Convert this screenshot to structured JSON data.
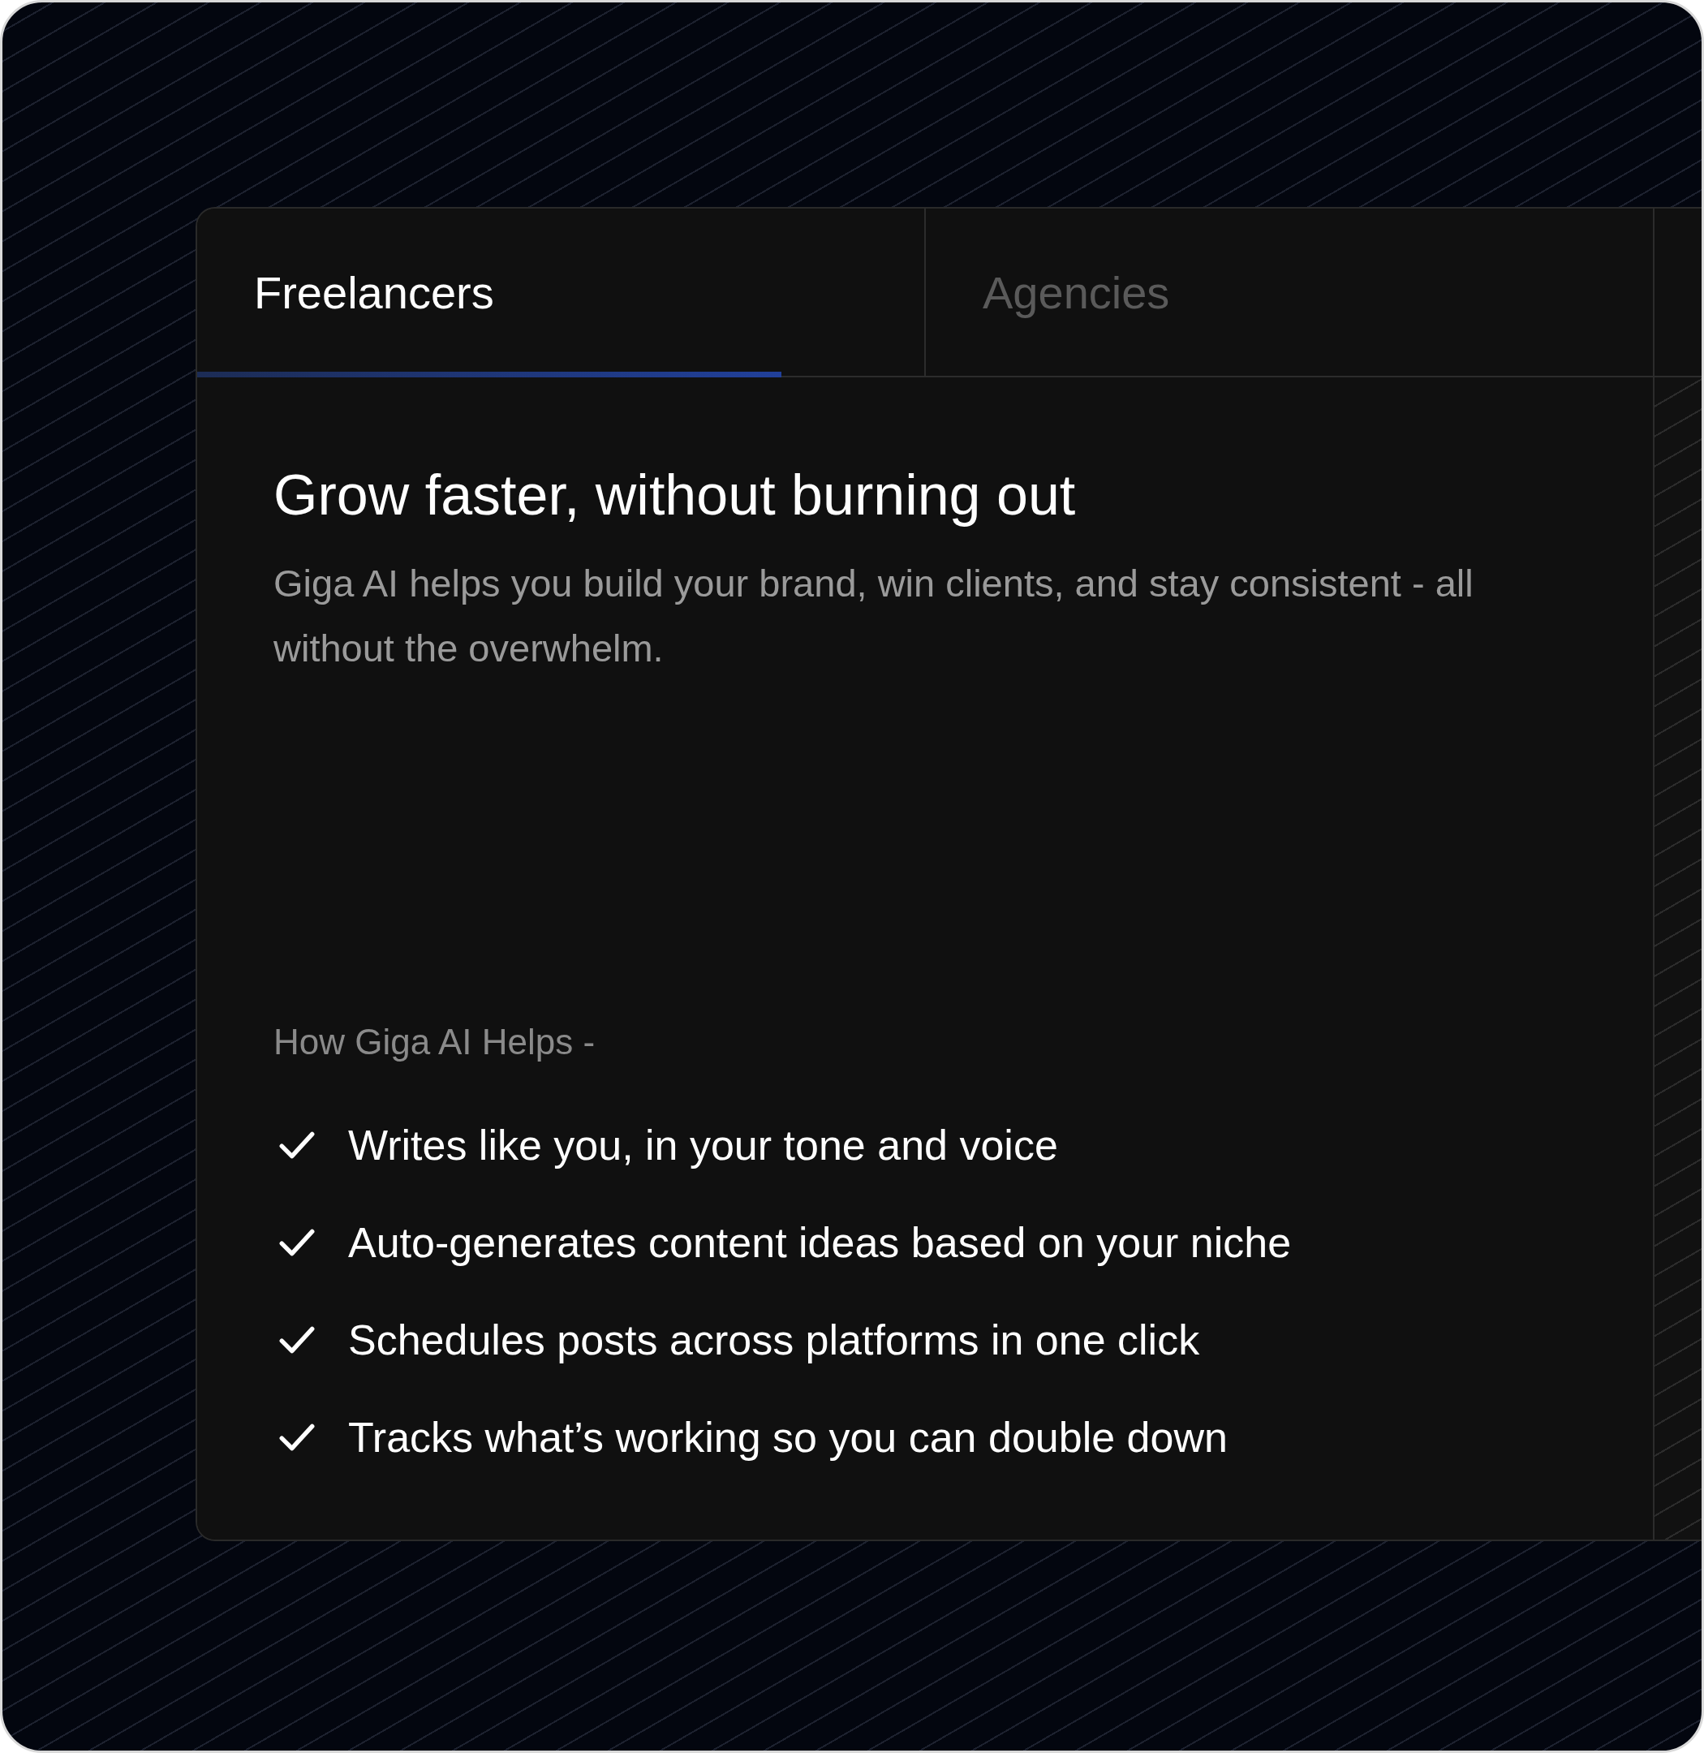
{
  "tabs": [
    {
      "label": "Freelancers",
      "selected": true
    },
    {
      "label": "Agencies",
      "selected": false
    }
  ],
  "panel": {
    "title": "Grow faster, without burning out",
    "description": "Giga AI helps you build your brand, win clients, and stay consistent - all without the overwhelm.",
    "helps_heading": "How Giga AI Helps -",
    "features": [
      {
        "text": "Writes like you, in your tone and voice",
        "checked": true
      },
      {
        "text": "Auto-generates content ideas based on your niche",
        "checked": true
      },
      {
        "text": "Schedules posts across platforms in one click",
        "checked": true
      },
      {
        "text": "Tracks what’s working so you can double down",
        "checked": true
      }
    ]
  }
}
